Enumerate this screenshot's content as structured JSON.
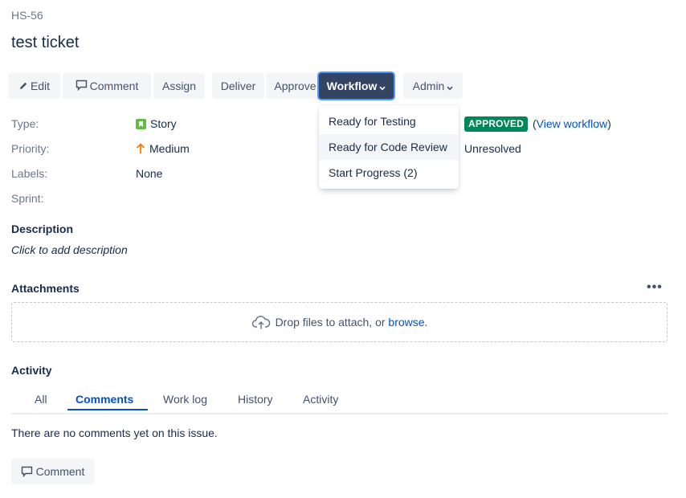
{
  "issue": {
    "key": "HS-56",
    "title": "test ticket"
  },
  "toolbar": {
    "edit": "Edit",
    "comment": "Comment",
    "assign": "Assign",
    "deliver": "Deliver",
    "approve": "Approve",
    "workflow": "Workflow",
    "admin": "Admin"
  },
  "workflow_menu": {
    "items": [
      "Ready for Testing",
      "Ready for Code Review",
      "Start Progress (2)"
    ]
  },
  "fields": {
    "type_label": "Type:",
    "type_value": "Story",
    "priority_label": "Priority:",
    "priority_value": "Medium",
    "labels_label": "Labels:",
    "labels_value": "None",
    "sprint_label": "Sprint:"
  },
  "status": {
    "badge": "APPROVED",
    "open_paren": "(",
    "view_workflow": "View workflow",
    "close_paren": ")",
    "resolution": "Unresolved"
  },
  "description": {
    "heading": "Description",
    "placeholder": "Click to add description"
  },
  "attachments": {
    "heading": "Attachments",
    "more": "•••",
    "drop_text": "Drop files to attach, or ",
    "browse": "browse."
  },
  "activity": {
    "heading": "Activity",
    "tabs": [
      "All",
      "Comments",
      "Work log",
      "History",
      "Activity"
    ],
    "active_tab": "Comments",
    "empty_text": "There are no comments yet on this issue.",
    "comment_button": "Comment"
  },
  "colors": {
    "approved_badge": "#00875a",
    "workflow_button": "#344563",
    "link": "#0052cc",
    "story_icon": "#65ba43",
    "priority_icon": "#ff7a00"
  },
  "icons": {
    "edit": "pencil-icon",
    "comment": "speech-bubble-icon",
    "dropdown": "chevron-down-icon",
    "type": "story-icon",
    "priority": "arrow-up-icon",
    "upload": "cloud-upload-icon",
    "more": "more-icon"
  }
}
